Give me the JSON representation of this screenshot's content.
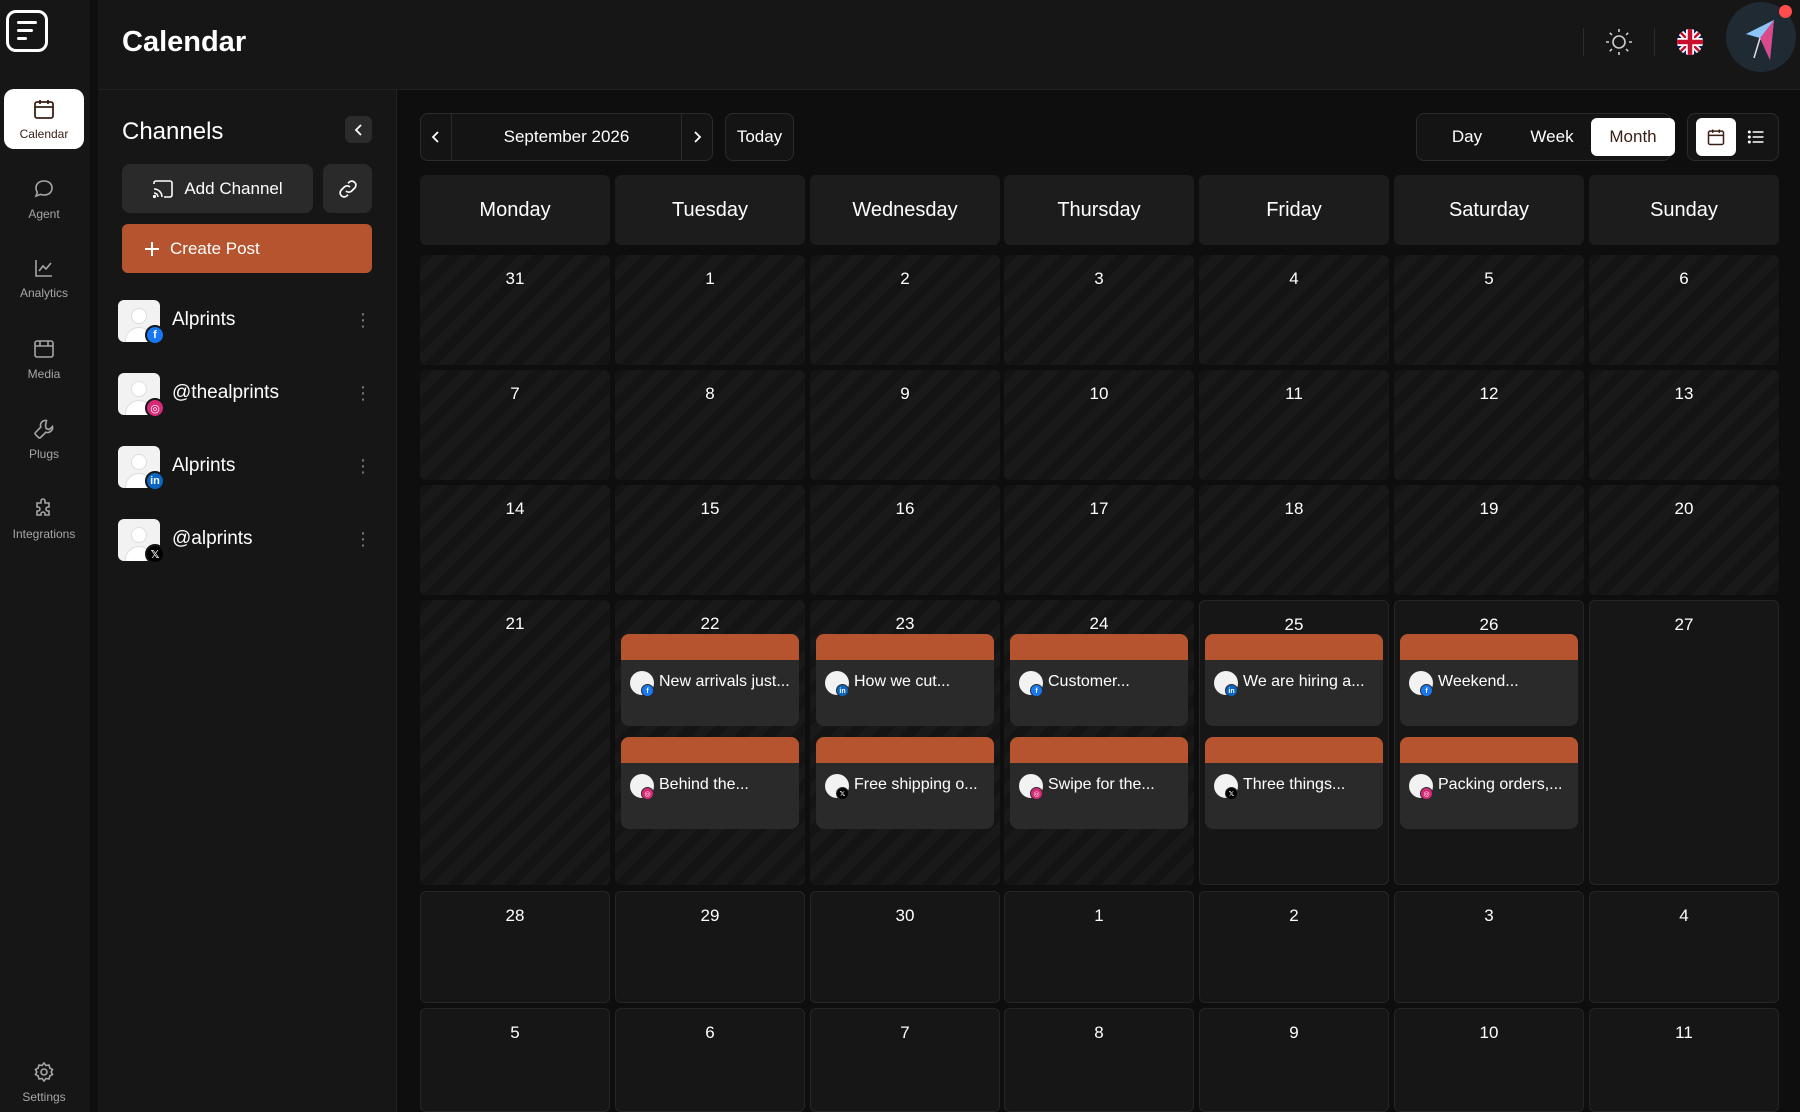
{
  "app": {
    "title": "Calendar"
  },
  "nav": [
    {
      "key": "calendar",
      "label": "Calendar",
      "icon": "calendar-icon",
      "active": true
    },
    {
      "key": "agent",
      "label": "Agent",
      "icon": "chat-icon"
    },
    {
      "key": "analytics",
      "label": "Analytics",
      "icon": "trend-chart-icon"
    },
    {
      "key": "media",
      "label": "Media",
      "icon": "media-icon"
    },
    {
      "key": "plugs",
      "label": "Plugs",
      "icon": "wrench-icon"
    },
    {
      "key": "integrations",
      "label": "Integrations",
      "icon": "puzzle-icon"
    },
    {
      "key": "settings",
      "label": "Settings",
      "icon": "gear-icon"
    }
  ],
  "channels": {
    "title": "Channels",
    "add_label": "Add Channel",
    "create_label": "Create Post",
    "items": [
      {
        "name": "Alprints",
        "network": "facebook"
      },
      {
        "name": "@thealprints",
        "network": "instagram"
      },
      {
        "name": "Alprints",
        "network": "linkedin"
      },
      {
        "name": "@alprints",
        "network": "x"
      }
    ]
  },
  "toolbar": {
    "current_period": "September 2026",
    "today_label": "Today",
    "views": [
      "Day",
      "Week",
      "Month"
    ],
    "active_view": "Month"
  },
  "weekdays": [
    "Monday",
    "Tuesday",
    "Wednesday",
    "Thursday",
    "Friday",
    "Saturday",
    "Sunday"
  ],
  "weeks": [
    [
      "31",
      "1",
      "2",
      "3",
      "4",
      "5",
      "6"
    ],
    [
      "7",
      "8",
      "9",
      "10",
      "11",
      "12",
      "13"
    ],
    [
      "14",
      "15",
      "16",
      "17",
      "18",
      "19",
      "20"
    ],
    [
      "21",
      "22",
      "23",
      "24",
      "25",
      "26",
      "27"
    ],
    [
      "28",
      "29",
      "30",
      "1",
      "2",
      "3",
      "4"
    ],
    [
      "5",
      "6",
      "7",
      "8",
      "9",
      "10",
      "11"
    ]
  ],
  "posts": [
    {
      "week": 3,
      "day": 1,
      "slot": 0,
      "text": "New arrivals just...",
      "network": "facebook"
    },
    {
      "week": 3,
      "day": 1,
      "slot": 1,
      "text": "Behind the...",
      "network": "instagram"
    },
    {
      "week": 3,
      "day": 2,
      "slot": 0,
      "text": "How we cut...",
      "network": "linkedin"
    },
    {
      "week": 3,
      "day": 2,
      "slot": 1,
      "text": "Free shipping o...",
      "network": "x"
    },
    {
      "week": 3,
      "day": 3,
      "slot": 0,
      "text": "Customer...",
      "network": "facebook"
    },
    {
      "week": 3,
      "day": 3,
      "slot": 1,
      "text": "Swipe for the...",
      "network": "instagram"
    },
    {
      "week": 3,
      "day": 4,
      "slot": 0,
      "text": "We are hiring a...",
      "network": "linkedin"
    },
    {
      "week": 3,
      "day": 4,
      "slot": 1,
      "text": "Three things...",
      "network": "x"
    },
    {
      "week": 3,
      "day": 5,
      "slot": 0,
      "text": "Weekend...",
      "network": "facebook"
    },
    {
      "week": 3,
      "day": 5,
      "slot": 1,
      "text": "Packing orders,...",
      "network": "instagram"
    }
  ],
  "colors": {
    "accent": "#b5542f",
    "facebook": "#1877f2",
    "instagram": "#d62976",
    "linkedin": "#0a66c2",
    "x": "#000000"
  }
}
